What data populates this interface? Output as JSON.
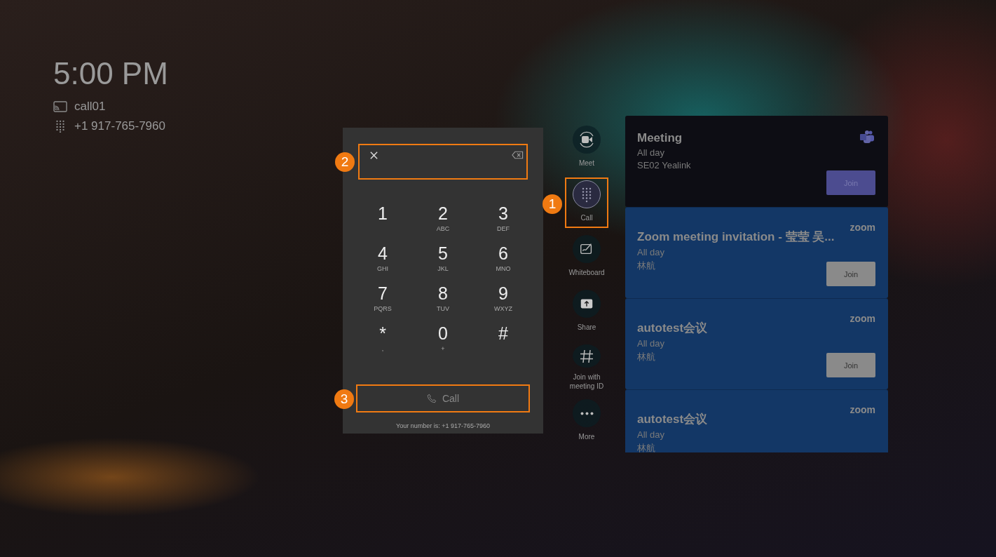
{
  "status": {
    "time": "5:00 PM",
    "device_name": "call01",
    "phone_number": "+1 917-765-7960"
  },
  "dialpad": {
    "input": {
      "callout": "2"
    },
    "keys": [
      {
        "digit": "1"
      },
      {
        "digit": "2",
        "letters": "ABC"
      },
      {
        "digit": "3",
        "letters": "DEF"
      },
      {
        "digit": "4",
        "letters": "GHI"
      },
      {
        "digit": "5",
        "letters": "JKL"
      },
      {
        "digit": "6",
        "letters": "MNO"
      },
      {
        "digit": "7",
        "letters": "PQRS"
      },
      {
        "digit": "8",
        "letters": "TUV"
      },
      {
        "digit": "9",
        "letters": "WXYZ"
      },
      {
        "digit": "*",
        "letters": ","
      },
      {
        "digit": "0",
        "letters": "+"
      },
      {
        "digit": "#"
      }
    ],
    "call_button": {
      "label": "Call",
      "disabled": true,
      "callout": "3"
    },
    "footer": "Your number is: +1 917-765-7960"
  },
  "sidebar": {
    "items": [
      {
        "kind": "meet",
        "label": "Meet",
        "selected": false
      },
      {
        "kind": "call",
        "label": "Call",
        "selected": true,
        "callout": "1"
      },
      {
        "kind": "whiteboard",
        "label": "Whiteboard",
        "selected": false
      },
      {
        "kind": "share",
        "label": "Share",
        "selected": false
      },
      {
        "kind": "meeting-id",
        "label": "Join with meeting ID",
        "selected": false
      },
      {
        "kind": "more",
        "label": "More",
        "selected": false
      }
    ]
  },
  "meetings": [
    {
      "kind": "teams",
      "title": "Meeting",
      "time": "All day",
      "organizer": "SE02 Yealink",
      "join": "Join"
    },
    {
      "kind": "zoom",
      "logo": "zoom",
      "title": "Zoom meeting invitation - 莹莹 吴...",
      "time": "All day",
      "organizer": "林航",
      "join": "Join"
    },
    {
      "kind": "zoom",
      "logo": "zoom",
      "title": "autotest会议",
      "time": "All day",
      "organizer": "林航",
      "join": "Join"
    },
    {
      "kind": "zoom",
      "logo": "zoom",
      "title": "autotest会议",
      "time": "All day",
      "organizer": "林航"
    }
  ]
}
